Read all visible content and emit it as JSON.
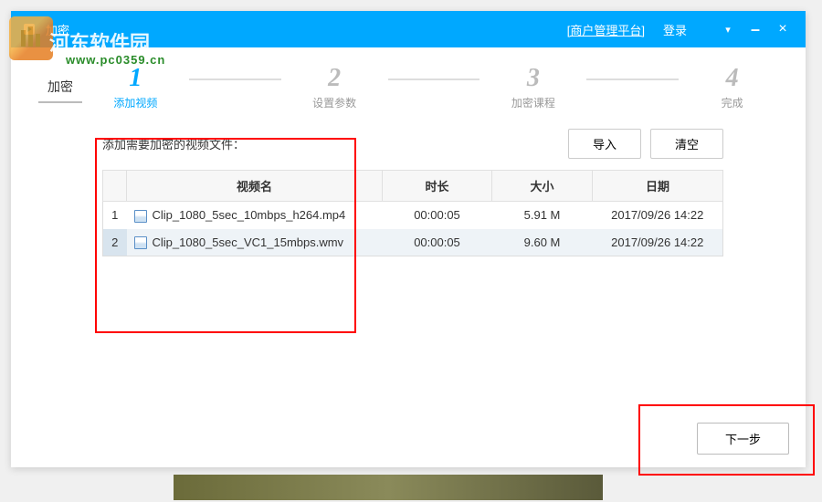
{
  "watermark": {
    "site_name": "河东软件园",
    "site_url": "www.pc0359.cn"
  },
  "titlebar": {
    "title": "加密",
    "merchant_link": "[商户管理平台]",
    "login": "登录"
  },
  "steps": {
    "tab": "加密",
    "items": [
      {
        "num": "1",
        "label": "添加视频",
        "active": true
      },
      {
        "num": "2",
        "label": "设置参数",
        "active": false
      },
      {
        "num": "3",
        "label": "加密课程",
        "active": false
      },
      {
        "num": "4",
        "label": "完成",
        "active": false
      }
    ]
  },
  "content": {
    "prompt": "添加需要加密的视频文件：",
    "import_btn": "导入",
    "clear_btn": "清空"
  },
  "table": {
    "headers": {
      "name": "视频名",
      "duration": "时长",
      "size": "大小",
      "date": "日期"
    },
    "rows": [
      {
        "idx": "1",
        "name": "Clip_1080_5sec_10mbps_h264.mp4",
        "duration": "00:00:05",
        "size": "5.91 M",
        "date": "2017/09/26 14:22",
        "selected": false
      },
      {
        "idx": "2",
        "name": "Clip_1080_5sec_VC1_15mbps.wmv",
        "duration": "00:00:05",
        "size": "9.60 M",
        "date": "2017/09/26 14:22",
        "selected": true
      }
    ]
  },
  "footer": {
    "next_btn": "下一步"
  }
}
